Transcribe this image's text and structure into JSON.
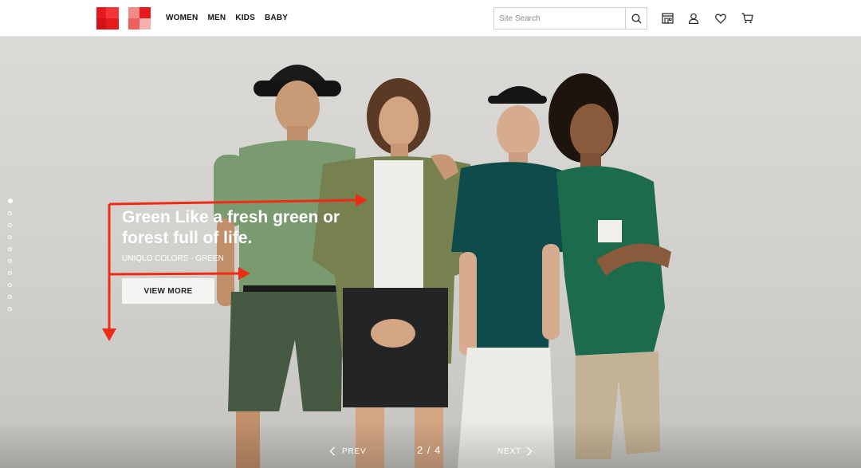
{
  "header": {
    "nav": [
      "WOMEN",
      "MEN",
      "KIDS",
      "BABY"
    ],
    "search": {
      "placeholder": "Site Search"
    },
    "icons": [
      "store-icon",
      "account-icon",
      "heart-icon",
      "cart-icon"
    ]
  },
  "hero": {
    "headline": "Green Like a fresh green or forest full of life.",
    "subline": "UNIQLO COLORS - GREEN",
    "cta": "VIEW MORE",
    "dots_count": 10,
    "active_dot": 0,
    "prev_label": "PREV",
    "next_label": "NEXT",
    "counter": "2 / 4"
  },
  "colors": {
    "brand_red": "#e8191d",
    "annotation_red": "#ee2b14"
  }
}
